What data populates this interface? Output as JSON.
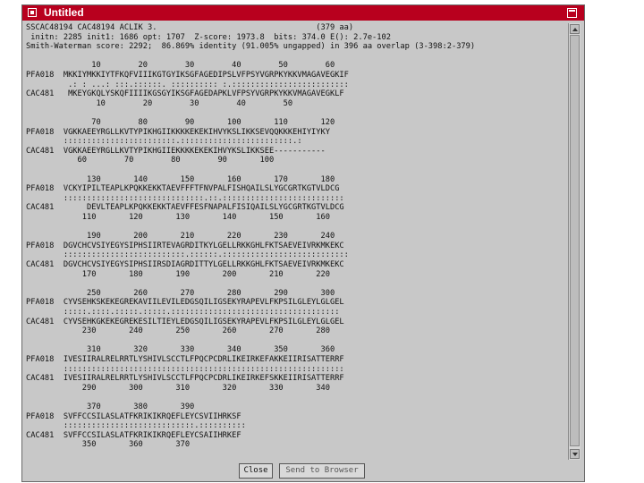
{
  "window": {
    "title": "Untitled"
  },
  "alignment_lines": [
    "SSCAC48194 CAC48194 ACLIK 3.                                  (379 aa)",
    " initn: 2285 init1: 1686 opt: 1707  Z-score: 1973.8  bits: 374.0 E(): 2.7e-102",
    "Smith-Waterman score: 2292;  86.869% identity (91.005% ungapped) in 396 aa overlap (3-398:2-379)",
    "",
    "              10        20        30        40        50        60",
    "PFA018  MKKIYMKKIYTFKQFVIIIKGTGYIKSGFAGEDIPSLVFPSYVGRPKYKKVMAGAVEGKIF",
    "         .: : ...: :::.::::::. :::::::::: :.:::::::::::::::::::::::::",
    "CAC481   MKEYGKQLYSKQFIIIIKGSGYIKSGFAGEDAPKLVFPSYVGRPKYKKVMAGAVEGKLF",
    "               10        20        30        40        50",
    "",
    "              70        80        90       100       110       120",
    "PFA018  VGKKAEEYRGLLKVTYPIKHGIIKKKKEKEKIHVYKSLIKKSEVQQKKKEHIYIYKY",
    "        ::::::::::::::::::::::::.::::::::::::::::::::::::.:",
    "CAC481  VGKKAEEYRGLLKVTYPIKHGIIEKKKKEKEKIHVYKSLIKKSEE-----------",
    "           60        70        80        90       100",
    "",
    "             130       140       150       160       170       180",
    "PFA018  VCKYIPILTEAPLKPQKKEKKTAEVFFFTFNVPALFISHQAILSLYGCGRTKGTVLDCG",
    "        ::::::::::::::::::::::::::::::.::.::::::::::::::::::::::::::",
    "CAC481       DEVLTEAPLKPQKKEKKTAEVFFESFNAPALFISIQAILSLYGCGRTKGTVLDCG",
    "            110       120       130       140       150       160",
    "",
    "             190       200       210       220       230       240",
    "PFA018  DGVCHCVSIYEGYSIPHSIIRTEVAGRDITKYLGELLRKKGHLFKTSAEVEIVRKMKEKC",
    "        ::::::::::::::::::::::::::.::::::.:::::::::::::::::::::::::::",
    "CAC481  DGVCHCVSIYEGYSIPHSIIRSDIAGRDITTYLGELLRKKGHLFKTSAEVEIVRKMKEKC",
    "            170       180       190       200       210       220",
    "",
    "             250       260       270       280       290       300",
    "PFA018  CYVSEHKSKEKEGREKAVIILEVILEDGSQILIGSEKYRAPEVLFKPSILGLEYLGLGEL",
    "        :::::.::::.:::::.:::::.::::::::::::::::::::::::::::::::::::",
    "CAC481  CYVSEHKGKEKEGREKESILTIEYLEDGSQILIGSEKYRAPEVLFKPSILGLEYLGLGEL",
    "            230       240       250       260       270       280",
    "",
    "             310       320       330       340       350       360",
    "PFA018  IVESIIRALRELRRTLYSHIVLSCCTLFPQCPCDRLIKEIRKEFAKKEIIRISATTERRF",
    "        ::::::::::::::::::::::::::::::::::::::::::::::::::::::::::::",
    "CAC481  IVESIIRALRELRRTLYSHIVLSCCTLFPQCPCDRLIKEIRKEFSKKEIIRISATTERRF",
    "            290       300       310       320       330       340",
    "",
    "             370       380       390",
    "PFA018  SVFFCCSILASLATFKRIKIKRQEFLEYCSVIIHRKSF",
    "        ::::::::::::::::::::::::::::.::::::::::",
    "CAC481  SVFFCCSILASLATFKRIKIKRQEFLEYCSAIIHRKEF",
    "            350       360       370"
  ],
  "buttons": {
    "close": "Close",
    "send": "Send to Browser"
  }
}
